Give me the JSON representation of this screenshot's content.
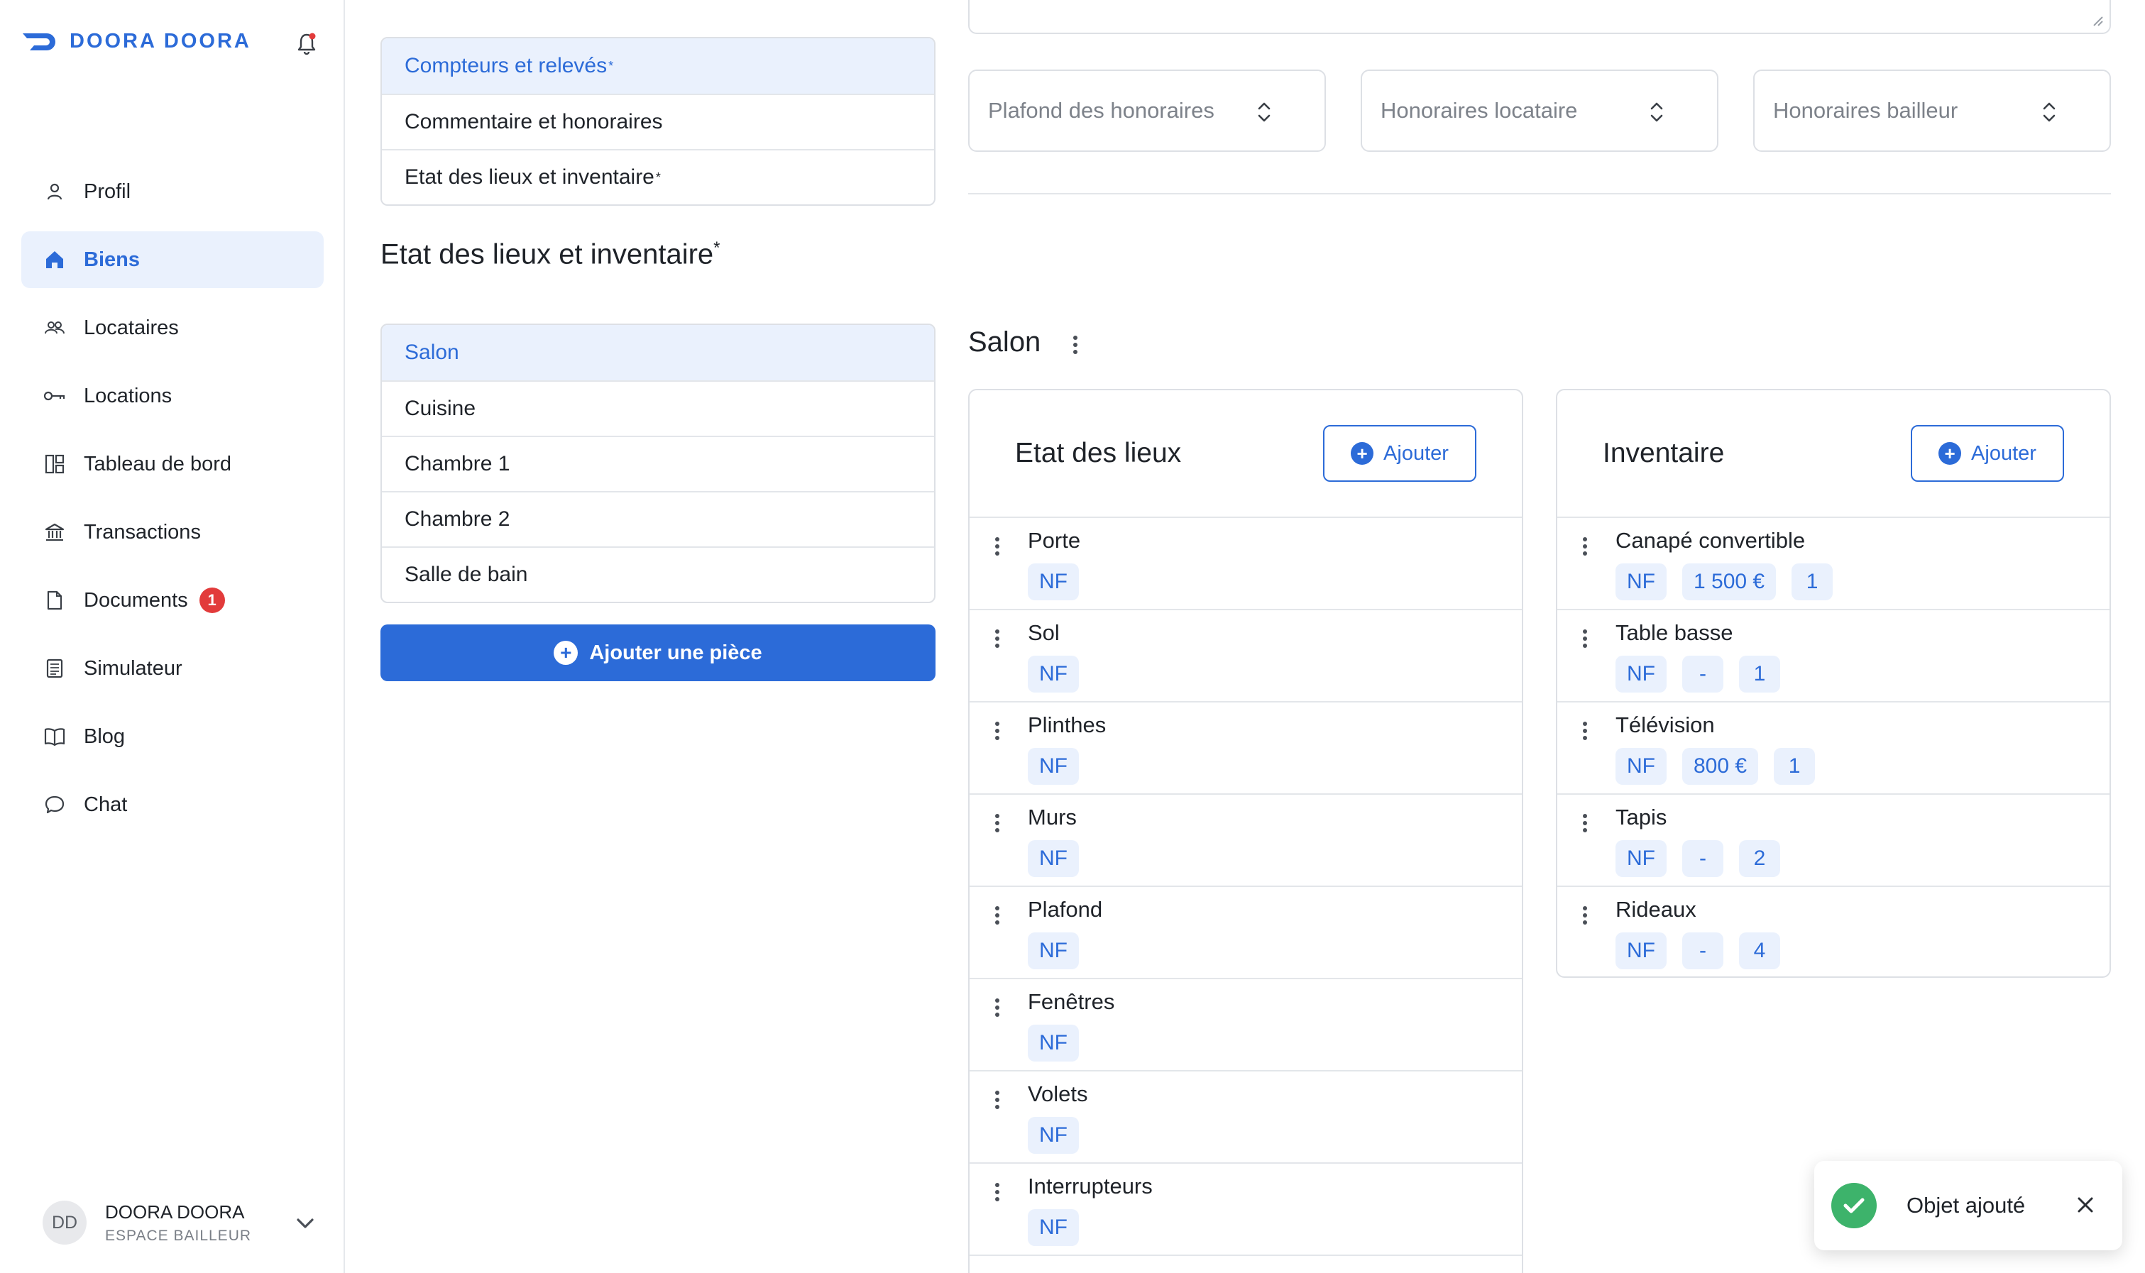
{
  "app": {
    "brand": "DOORA DOORA",
    "colors": {
      "accent": "#2c6bd8",
      "accent_light": "#eaf1fd",
      "badge": "#e23b3b",
      "success": "#3db36b",
      "border": "#dde0e5"
    }
  },
  "sidebar": {
    "items": [
      {
        "label": "Profil",
        "icon": "user-icon"
      },
      {
        "label": "Biens",
        "icon": "home-icon",
        "active": true
      },
      {
        "label": "Locataires",
        "icon": "users-icon"
      },
      {
        "label": "Locations",
        "icon": "key-icon"
      },
      {
        "label": "Tableau de bord",
        "icon": "dashboard-icon"
      },
      {
        "label": "Transactions",
        "icon": "bank-icon"
      },
      {
        "label": "Documents",
        "icon": "document-icon",
        "badge": "1"
      },
      {
        "label": "Simulateur",
        "icon": "calculator-icon"
      },
      {
        "label": "Blog",
        "icon": "book-icon"
      },
      {
        "label": "Chat",
        "icon": "chat-icon"
      }
    ],
    "user": {
      "initials": "DD",
      "name": "DOORA DOORA",
      "role": "ESPACE BAILLEUR"
    }
  },
  "sections_nav": {
    "items": [
      {
        "label": "Compteurs et relevés",
        "required": "*",
        "active": true
      },
      {
        "label": "Commentaire et honoraires",
        "required": ""
      },
      {
        "label": "Etat des lieux et inventaire",
        "required": "*"
      }
    ]
  },
  "inventory_section": {
    "title": "Etat des lieux et inventaire",
    "required": "*",
    "rooms": [
      "Salon",
      "Cuisine",
      "Chambre 1",
      "Chambre 2",
      "Salle de bain"
    ],
    "active_room": "Salon",
    "add_room_label": "Ajouter une pièce"
  },
  "fees": {
    "fields": [
      {
        "placeholder": "Plafond des honoraires"
      },
      {
        "placeholder": "Honoraires locataire"
      },
      {
        "placeholder": "Honoraires bailleur"
      }
    ]
  },
  "room": {
    "title": "Salon",
    "etat_des_lieux": {
      "title": "Etat des lieux",
      "add_label": "Ajouter",
      "items": [
        {
          "name": "Porte",
          "tags": [
            "NF"
          ]
        },
        {
          "name": "Sol",
          "tags": [
            "NF"
          ]
        },
        {
          "name": "Plinthes",
          "tags": [
            "NF"
          ]
        },
        {
          "name": "Murs",
          "tags": [
            "NF"
          ]
        },
        {
          "name": "Plafond",
          "tags": [
            "NF"
          ]
        },
        {
          "name": "Fenêtres",
          "tags": [
            "NF"
          ]
        },
        {
          "name": "Volets",
          "tags": [
            "NF"
          ]
        },
        {
          "name": "Interrupteurs",
          "tags": [
            "NF"
          ]
        }
      ]
    },
    "inventaire": {
      "title": "Inventaire",
      "add_label": "Ajouter",
      "items": [
        {
          "name": "Canapé convertible",
          "tags": [
            "NF",
            "1 500 €",
            "1"
          ]
        },
        {
          "name": "Table basse",
          "tags": [
            "NF",
            "-",
            "1"
          ]
        },
        {
          "name": "Télévision",
          "tags": [
            "NF",
            "800 €",
            "1"
          ]
        },
        {
          "name": "Tapis",
          "tags": [
            "NF",
            "-",
            "2"
          ]
        },
        {
          "name": "Rideaux",
          "tags": [
            "NF",
            "-",
            "4"
          ]
        }
      ]
    }
  },
  "toast": {
    "message": "Objet ajouté"
  }
}
